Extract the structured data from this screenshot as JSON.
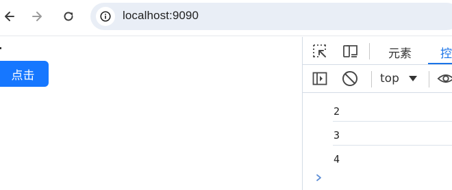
{
  "browser": {
    "url": "localhost:9090",
    "icons": {
      "back": "arrow-left-icon",
      "forward": "arrow-right-icon",
      "reload": "reload-icon",
      "site_info": "site-info-icon"
    }
  },
  "page": {
    "button_label": "点击",
    "button_color": "#1677ff"
  },
  "devtools": {
    "tabs": [
      {
        "label": "元素",
        "active": false
      },
      {
        "label": "控",
        "active": true
      }
    ],
    "toolbar": {
      "context": "top"
    },
    "console_lines": [
      "2",
      "3",
      "4"
    ],
    "accent_color": "#1a73e8"
  }
}
